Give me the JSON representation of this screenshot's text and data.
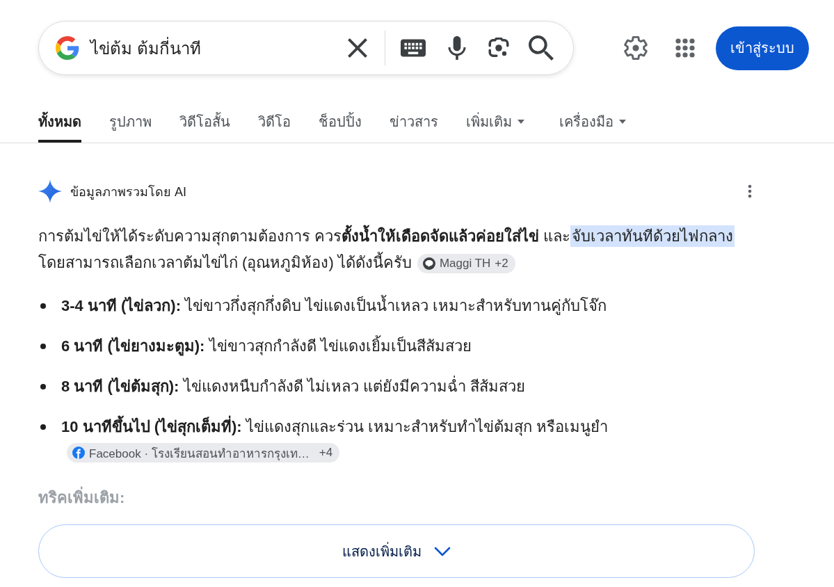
{
  "search": {
    "query": "ไข่ต้ม ต้มกี่นาที"
  },
  "account": {
    "sign_in": "เข้าสู่ระบบ"
  },
  "tabs": [
    {
      "label": "ทั้งหมด",
      "selected": true,
      "has_menu": false
    },
    {
      "label": "รูปภาพ",
      "selected": false,
      "has_menu": false
    },
    {
      "label": "วิดีโอสั้น",
      "selected": false,
      "has_menu": false
    },
    {
      "label": "วิดีโอ",
      "selected": false,
      "has_menu": false
    },
    {
      "label": "ช็อปปิ้ง",
      "selected": false,
      "has_menu": false
    },
    {
      "label": "ข่าวสาร",
      "selected": false,
      "has_menu": false
    },
    {
      "label": "เพิ่มเติม",
      "selected": false,
      "has_menu": true
    },
    {
      "label": "เครื่องมือ",
      "selected": false,
      "has_menu": true
    }
  ],
  "ai_overview": {
    "title": "ข้อมูลภาพรวมโดย AI",
    "intro": {
      "segments": [
        {
          "kind": "plain",
          "text": "การต้มไข่ให้ได้ระดับความสุกตามต้องการ ควร**ตั้งน้ำให้เดือดจัดแล้วค่อยใส่ไข่** และ"
        },
        {
          "kind": "highlight",
          "text": "จับเวลาทันทีด้วยไฟกลาง"
        },
        {
          "kind": "plain",
          "text": " โดยสามารถเลือกเวลาต้มไข่ไก่ (อุณหภูมิห้อง) ได้ดังนี้ครับ"
        }
      ],
      "source": {
        "label": "Maggi TH",
        "more": "+2"
      }
    },
    "items": [
      {
        "text": "**3-4 นาที (ไข่ลวก):** ไข่ขาวกึ่งสุกกึ่งดิบ ไข่แดงเป็นน้ำเหลว เหมาะสำหรับทานคู่กับโจ๊ก"
      },
      {
        "text": "**6 นาที (ไข่ยางมะตูม):** ไข่ขาวสุกกำลังดี ไข่แดงเยิ้มเป็นสีส้มสวย"
      },
      {
        "text": "**8 นาที (ไข่ต้มสุก):** ไข่แดงหนืบกำลังดี ไม่เหลว แต่ยังมีความฉ่ำ สีส้มสวย"
      },
      {
        "text": "**10 นาทีขึ้นไป (ไข่สุกเต็มที่):** ไข่แดงสุกและร่วน เหมาะสำหรับทำไข่ต้มสุก หรือเมนูยำ",
        "source": {
          "label": "Facebook · โรงเรียนสอนทำอาหารกรุงเท…",
          "more": "+4"
        }
      }
    ],
    "faded_heading": "ทริคเพิ่มเติม:",
    "show_more": "แสดงเพิ่มเติม"
  }
}
